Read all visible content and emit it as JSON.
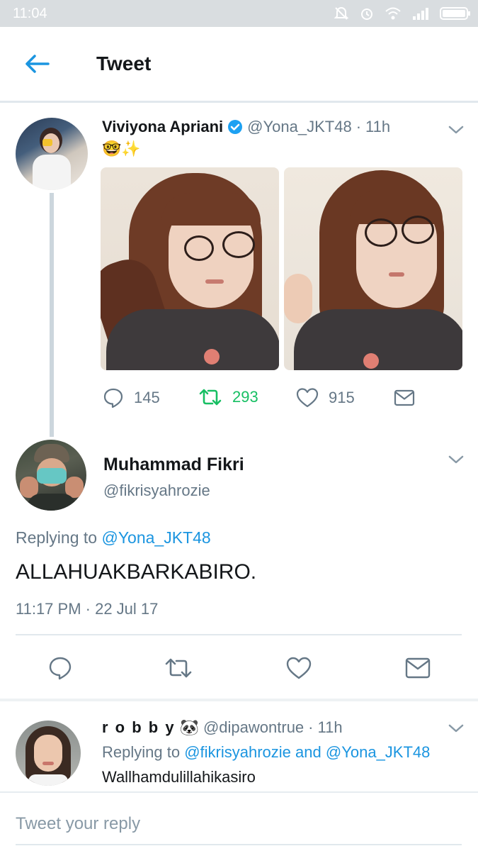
{
  "status_bar": {
    "time": "11:04"
  },
  "header": {
    "title": "Tweet"
  },
  "original_tweet": {
    "name": "Viviyona Apriani",
    "handle": "@Yona_JKT48",
    "time": "11h",
    "emoji": "🤓✨",
    "stats": {
      "replies": "145",
      "retweets": "293",
      "likes": "915"
    }
  },
  "focus_tweet": {
    "name": "Muhammad Fikri",
    "handle": "@fikrisyahrozie",
    "replying_label": "Replying to",
    "replying_to": "@Yona_JKT48",
    "text": "ALLAHUAKBARKABIRO.",
    "timestamp": "11:17 PM · 22 Jul 17"
  },
  "reply_tweet": {
    "name": "r o b b y",
    "name_emoji": "🐼",
    "handle": "@dipawontrue",
    "time": "11h",
    "replying_label": "Replying to",
    "replying_to_1": "@fikrisyahrozie",
    "replying_and": "and",
    "replying_to_2": "@Yona_JKT48",
    "text": "Wallhamdulillahikasiro"
  },
  "composer": {
    "placeholder": "Tweet your reply"
  },
  "colors": {
    "accent": "#1b95e0",
    "retweet": "#17bf63",
    "muted": "#657786",
    "verified": "#1da1f2"
  }
}
